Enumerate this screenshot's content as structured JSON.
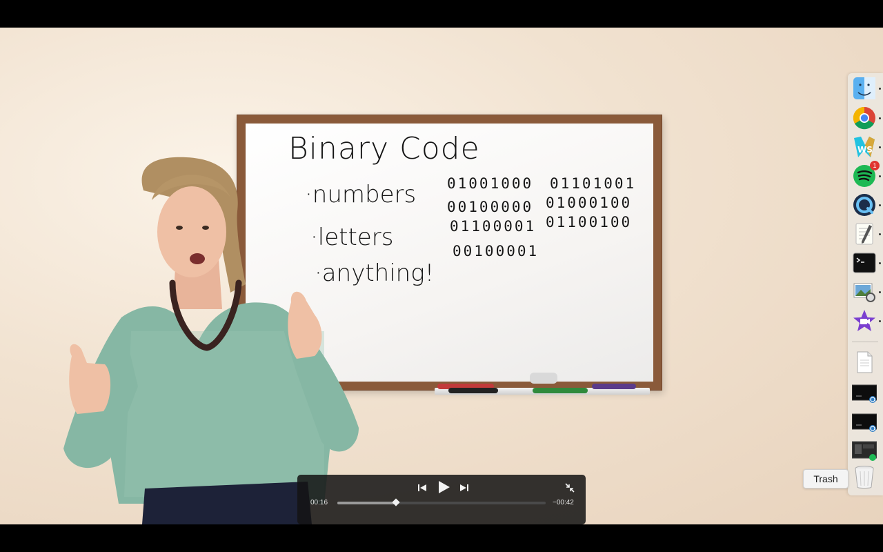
{
  "whiteboard": {
    "title": "Binary Code",
    "bullets": [
      "·numbers",
      "·letters",
      "·anything!"
    ],
    "binary_left": [
      "01001000",
      "00100000",
      "01100001",
      "00100001"
    ],
    "binary_right": [
      "01101001",
      "01000100",
      "01100100"
    ]
  },
  "player": {
    "elapsed": "00:16",
    "remaining": "−00:42",
    "progress": 0.28
  },
  "dock": {
    "items": [
      {
        "name": "finder",
        "icon": "finder-icon"
      },
      {
        "name": "chrome",
        "icon": "chrome-icon"
      },
      {
        "name": "webstorm",
        "icon": "webstorm-icon"
      },
      {
        "name": "spotify",
        "icon": "spotify-icon",
        "badge": "1"
      },
      {
        "name": "quicktime",
        "icon": "quicktime-icon"
      },
      {
        "name": "textedit",
        "icon": "textedit-icon"
      },
      {
        "name": "terminal",
        "icon": "terminal-icon"
      },
      {
        "name": "preview",
        "icon": "preview-icon"
      },
      {
        "name": "imovie",
        "icon": "imovie-icon"
      },
      {
        "name": "document",
        "icon": "document-icon"
      },
      {
        "name": "minimized-window-1",
        "icon": "window-thumbnail-icon"
      },
      {
        "name": "minimized-window-2",
        "icon": "window-thumbnail-icon"
      },
      {
        "name": "minimized-window-3",
        "icon": "window-thumbnail-icon"
      },
      {
        "name": "trash",
        "icon": "trash-icon"
      }
    ],
    "tooltip": "Trash"
  }
}
